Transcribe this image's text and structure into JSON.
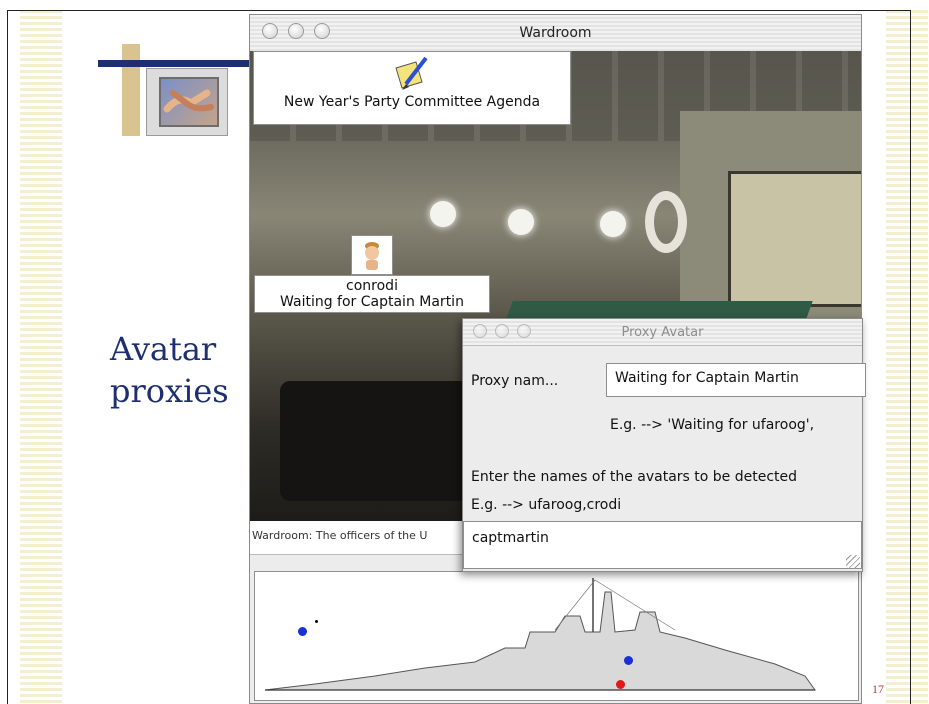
{
  "slide": {
    "heading_line1": "Avatar",
    "heading_line2": "proxies",
    "page_number": "17"
  },
  "wardroom_window": {
    "title": "Wardroom",
    "agenda_sign_label": "New Year's Party Committee Agenda",
    "avatar_name": "conrodi",
    "avatar_status": "Waiting for Captain Martin",
    "caption": "Wardroom: The officers of the U"
  },
  "proxy_dialog": {
    "title": "Proxy Avatar",
    "proxy_name_label": "Proxy nam...",
    "proxy_name_value": "Waiting for Captain Martin",
    "proxy_name_hint": "E.g. --> 'Waiting for ufaroog',",
    "detect_label": "Enter the names of the avatars to be detected",
    "detect_hint": "E.g. --> ufaroog,crodi",
    "detect_value": "captmartin"
  },
  "icons": {
    "agenda": "pen-and-paper-icon",
    "avatar": "avatar-head-icon",
    "window_controls": "traffic-light-buttons"
  },
  "colors": {
    "heading": "#1d2f6e",
    "page_number": "#c0392b",
    "map_dot_blue": "#1a2fd6",
    "map_dot_red": "#e01818"
  }
}
